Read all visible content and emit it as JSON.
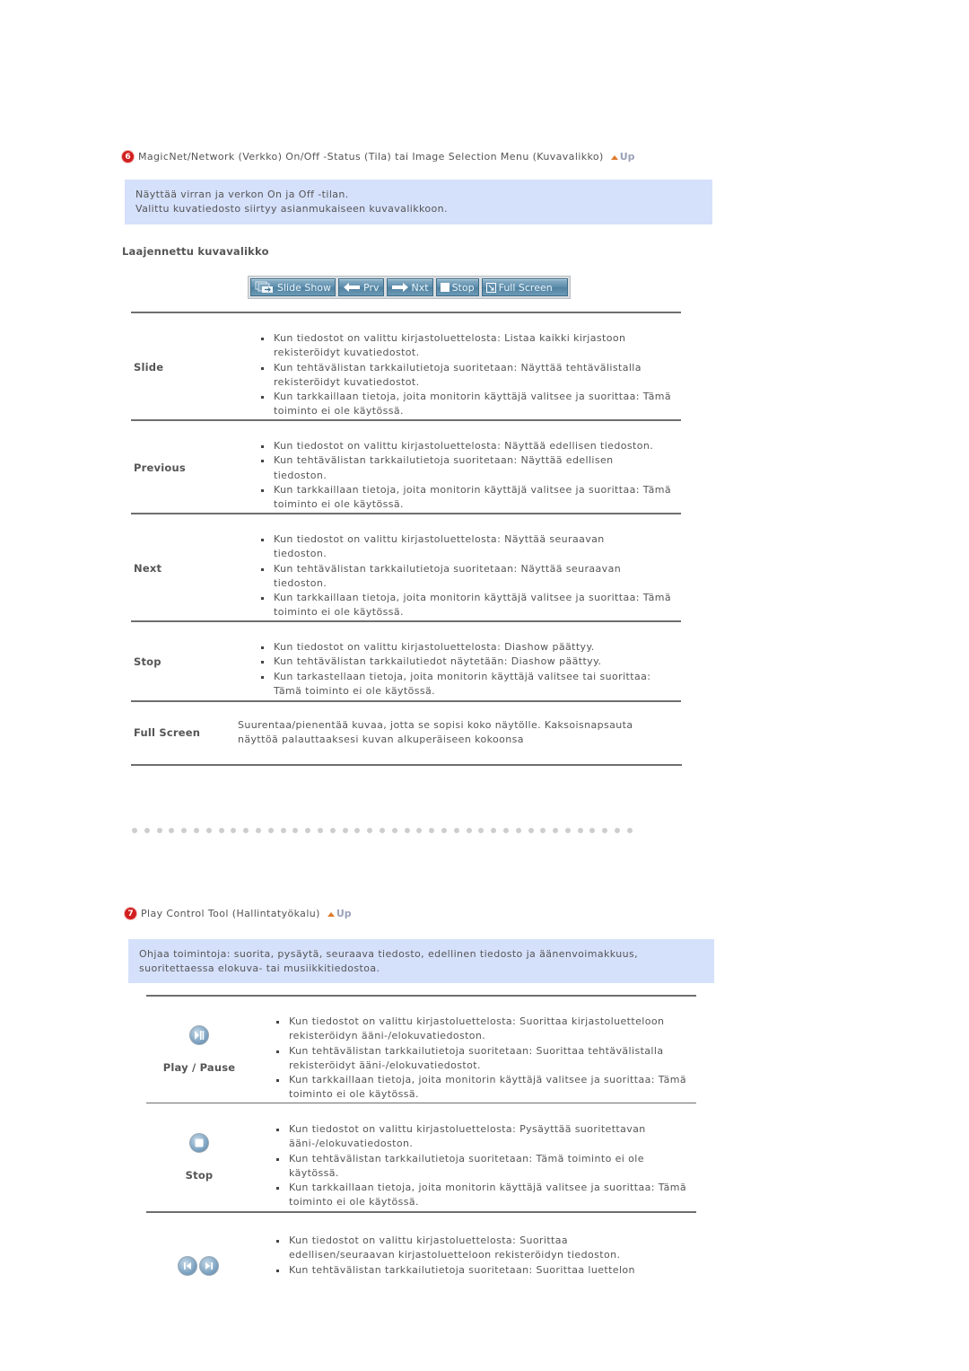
{
  "section6": {
    "number": "6",
    "title": "MagicNet/Network (Verkko) On/Off -Status (Tila) tai Image Selection Menu (Kuvavalikko)",
    "up_label": "Up",
    "info_lines": [
      "Näyttää virran ja verkon On ja Off -tilan.",
      "Valittu kuvatiedosto siirtyy asianmukaiseen kuvavalikkoon."
    ],
    "subheading": "Laajennettu kuvavalikko",
    "toolbar": [
      {
        "label": "Slide Show",
        "icon": "slideshow-icon"
      },
      {
        "label": "Prv",
        "icon": "arrow-left-icon"
      },
      {
        "label": "Nxt",
        "icon": "arrow-right-icon"
      },
      {
        "label": "Stop",
        "icon": "stop-square-icon"
      },
      {
        "label": "Full Screen",
        "icon": "fullscreen-icon"
      }
    ],
    "rows": [
      {
        "label": "Slide",
        "bullets": [
          "Kun tiedostot on valittu kirjastoluettelosta: Listaa kaikki kirjastoon rekisteröidyt kuvatiedostot.",
          "Kun tehtävälistan tarkkailutietoja suoritetaan: Näyttää tehtävälistalla rekisteröidyt kuvatiedostot.",
          "Kun tarkkaillaan tietoja, joita monitorin käyttäjä valitsee ja suorittaa: Tämä toiminto ei ole käytössä."
        ]
      },
      {
        "label": "Previous",
        "bullets": [
          "Kun tiedostot on valittu kirjastoluettelosta: Näyttää edellisen tiedoston.",
          "Kun tehtävälistan tarkkailutietoja suoritetaan: Näyttää edellisen tiedoston.",
          "Kun tarkkaillaan tietoja, joita monitorin käyttäjä valitsee ja suorittaa: Tämä toiminto ei ole käytössä."
        ]
      },
      {
        "label": "Next",
        "bullets": [
          "Kun tiedostot on valittu kirjastoluettelosta: Näyttää seuraavan tiedoston.",
          "Kun tehtävälistan tarkkailutietoja suoritetaan: Näyttää seuraavan tiedoston.",
          "Kun tarkkaillaan tietoja, joita monitorin käyttäjä valitsee ja suorittaa: Tämä toiminto ei ole käytössä."
        ]
      },
      {
        "label": "Stop",
        "bullets": [
          "Kun tiedostot on valittu kirjastoluettelosta: Diashow päättyy.",
          "Kun tehtävälistan tarkkailutiedot näytetään: Diashow päättyy.",
          "Kun tarkastellaan tietoja, joita monitorin käyttäjä valitsee tai suorittaa: Tämä toiminto ei ole käytössä."
        ]
      },
      {
        "label": "Full Screen",
        "text": "Suurentaa/pienentää kuvaa, jotta se sopisi koko näytölle. Kaksoisnapsauta näyttöä palauttaaksesi kuvan alkuperäiseen kokoonsa"
      }
    ]
  },
  "section7": {
    "number": "7",
    "title": "Play Control Tool (Hallintatyökalu)",
    "up_label": "Up",
    "info_text": "Ohjaa toimintoja: suorita, pysäytä, seuraava tiedosto, edellinen tiedosto ja äänenvoimakkuus, suoritettaessa elokuva- tai musiikkitiedostoa.",
    "rows": [
      {
        "label": "Play / Pause",
        "icon": "play-pause-icon",
        "bullets": [
          "Kun tiedostot on valittu kirjastoluettelosta: Suorittaa kirjastoluetteloon rekisteröidyn ääni-/elokuvatiedoston.",
          "Kun tehtävälistan tarkkailutietoja suoritetaan: Suorittaa tehtävälistalla rekisteröidyt ääni-/elokuvatiedostot.",
          "Kun tarkkaillaan tietoja, joita monitorin käyttäjä valitsee ja suorittaa: Tämä toiminto ei ole käytössä."
        ]
      },
      {
        "label": "Stop",
        "icon": "stop-icon",
        "bullets": [
          "Kun tiedostot on valittu kirjastoluettelosta: Pysäyttää suoritettavan ääni-/elokuvatiedoston.",
          "Kun tehtävälistan tarkkailutietoja suoritetaan: Tämä toiminto ei ole käytössä.",
          "Kun tarkkaillaan tietoja, joita monitorin käyttäjä valitsee ja suorittaa: Tämä toiminto ei ole käytössä."
        ]
      },
      {
        "label": "",
        "icon": "prev-next-icon",
        "bullets": [
          "Kun tiedostot on valittu kirjastoluettelosta: Suorittaa edellisen/seuraavan kirjastoluetteloon rekisteröidyn tiedoston.",
          "Kun tehtävälistan tarkkailutietoja suoritetaan: Suorittaa luettelon"
        ]
      }
    ]
  },
  "colors": {
    "info_box_bg": "#d5e0fb",
    "badge_red": "#d21f1f",
    "up_arrow": "#e07a2a",
    "text": "#555555",
    "rule": "#6e6e6e"
  }
}
